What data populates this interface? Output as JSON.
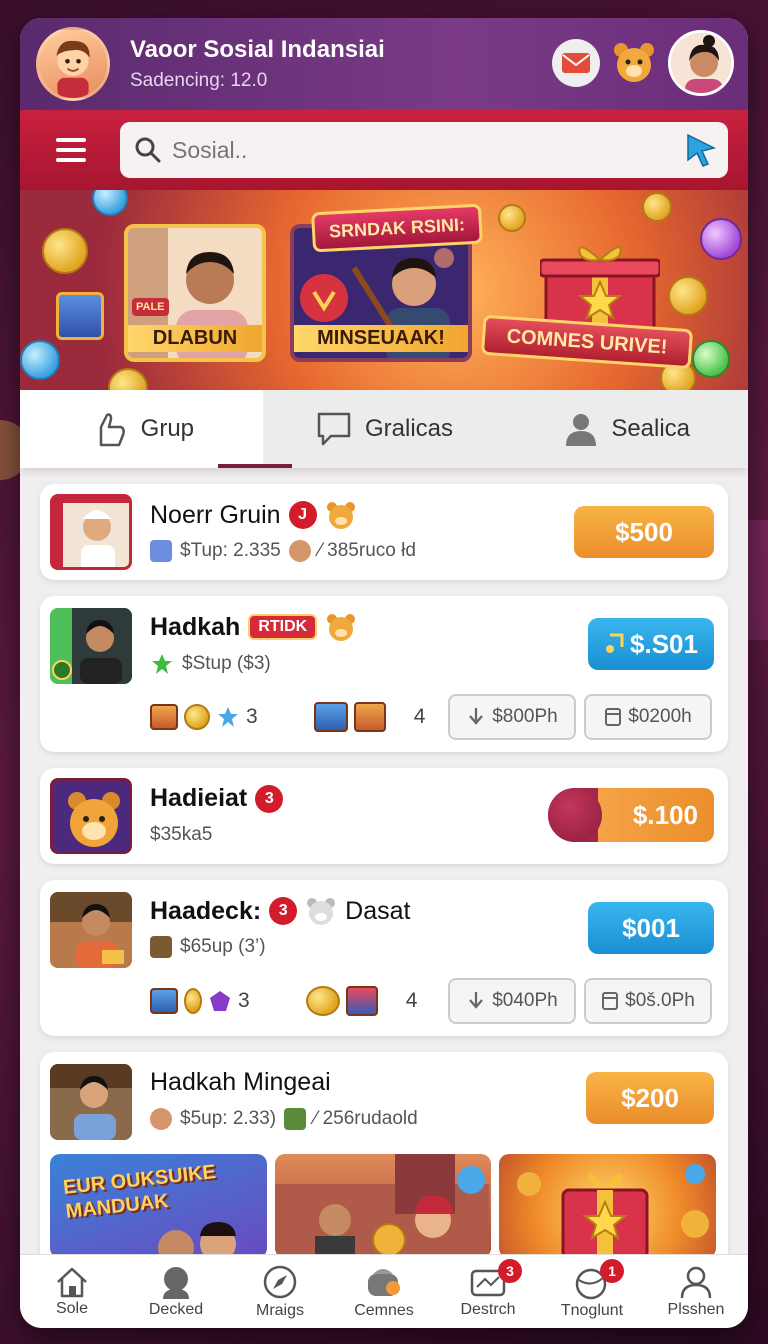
{
  "header": {
    "title": "Vaoor Sosial Indansiai",
    "subtitle": "Sadencing: 12.0"
  },
  "search": {
    "placeholder": "Sosial.."
  },
  "banner": {
    "card1_label": "DLABUN",
    "card1_tag": "PALE",
    "card2_label": "MINSEUAAK!",
    "ribbon": "SRNDAK RSINI:",
    "gift_label": "COMNES URIVE!"
  },
  "tabs": [
    {
      "label": "Grup",
      "icon": "hand-icon"
    },
    {
      "label": "Gralicas",
      "icon": "chat-icon"
    },
    {
      "label": "Sealica",
      "icon": "person-icon"
    }
  ],
  "rows": [
    {
      "name": "Noerr Gruin",
      "badge": "J",
      "sub1": "$Tup: 2.335",
      "sub2": "⁄ 385ruco łd",
      "price": "$500",
      "price_color": "orange"
    },
    {
      "name": "Hadkah",
      "tag": "RTIDK",
      "sub1": "$Stup ($3)",
      "count1": "3",
      "count2": "4",
      "price": "$.S01",
      "price_color": "blue",
      "btn1": "$800Ph",
      "btn2": "$0200h"
    },
    {
      "name": "Hadieiat",
      "badge": "3",
      "sub1": "$35ka5",
      "price": "$.100",
      "price_color": "orange"
    },
    {
      "name": "Haadeck:",
      "badge": "3",
      "name2": "Dasat",
      "sub1": "$65up (3’)",
      "count1": "3",
      "count2": "4",
      "price": "$001",
      "price_color": "blue",
      "btn1": "$040Ph",
      "btn2": "$0š.0Ph"
    },
    {
      "name": "Hadkah Mingeai",
      "sub1": "$5up: 2.33)",
      "sub2": "⁄ 256rudaold",
      "price": "$200",
      "price_color": "orange",
      "media1_text": "EUR OUKSUIKE MANDUAK"
    }
  ],
  "bottomnav": [
    {
      "label": "Sole",
      "icon": "home-icon"
    },
    {
      "label": "Decked",
      "icon": "profile-icon"
    },
    {
      "label": "Mraigs",
      "icon": "compass-icon"
    },
    {
      "label": "Cemnes",
      "icon": "games-icon"
    },
    {
      "label": "Destrch",
      "icon": "message-icon",
      "badge": "3"
    },
    {
      "label": "Tnoglunt",
      "icon": "globe-icon",
      "badge": "1"
    },
    {
      "label": "Plsshen",
      "icon": "person-icon"
    }
  ]
}
